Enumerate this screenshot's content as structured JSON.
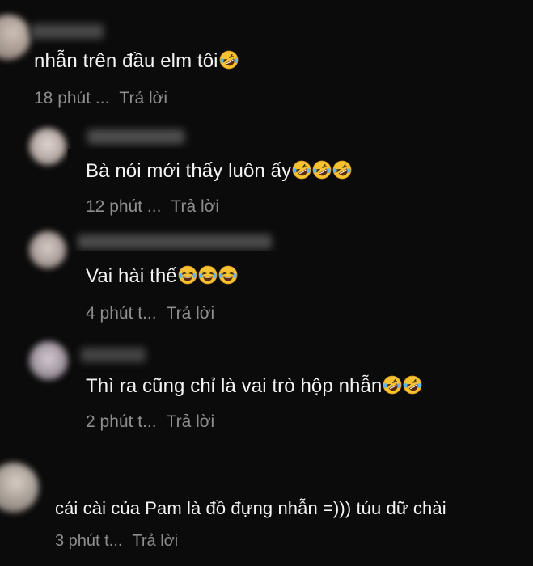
{
  "comments": [
    {
      "text": "nhẫn trên đầu elm tôi",
      "emojis": [
        "rofl-emoji"
      ],
      "time": "18 phút ...",
      "reply": "Trả lời"
    },
    {
      "text": "Bà nói mới thấy luôn ấy",
      "emojis": [
        "rofl-emoji",
        "rofl-emoji",
        "rofl-emoji"
      ],
      "time": "12 phút ...",
      "reply": "Trả lời"
    },
    {
      "text": "Vai hài thế",
      "emojis": [
        "joy-emoji",
        "joy-emoji",
        "joy-emoji"
      ],
      "time": "4 phút t...",
      "reply": "Trả lời"
    },
    {
      "text": "Thì ra cũng chỉ là vai trò hộp nhẫn",
      "emojis": [
        "rofl-emoji",
        "rofl-emoji"
      ],
      "time": "2 phút t...",
      "reply": "Trả lời"
    },
    {
      "text": "cái cài của Pam là đồ đựng nhẫn =))) túu dữ chài",
      "emojis": [],
      "time": "3 phút t...",
      "reply": "Trả lời"
    }
  ],
  "colors": {
    "background": "#0b0b0b",
    "text": "#f4f4f4",
    "meta": "#8e8e8e",
    "emoji_face": "#f7c232"
  }
}
